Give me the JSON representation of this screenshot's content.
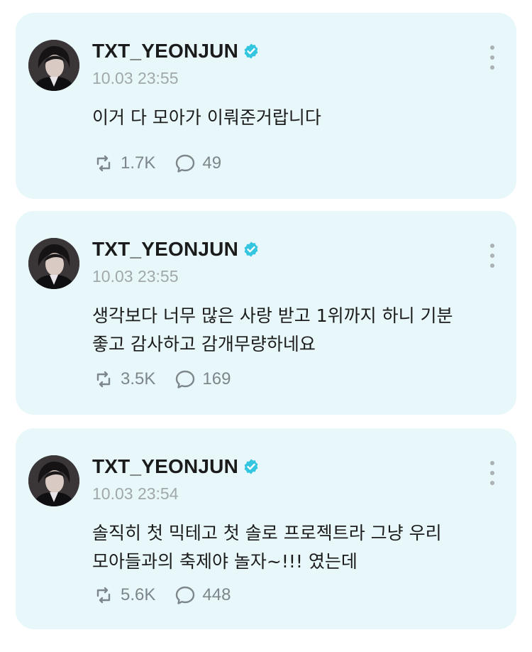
{
  "posts": [
    {
      "username": "TXT_YEONJUN",
      "timestamp": "10.03 23:55",
      "text": "이거 다 모아가 이뤄준거랍니다",
      "reposts": "1.7K",
      "comments": "49"
    },
    {
      "username": "TXT_YEONJUN",
      "timestamp": "10.03 23:55",
      "text": "생각보다 너무 많은 사랑 받고 1위까지 하니 기분\n좋고 감사하고 감개무량하네요",
      "reposts": "3.5K",
      "comments": "169"
    },
    {
      "username": "TXT_YEONJUN",
      "timestamp": "10.03 23:54",
      "text": "솔직히 첫 믹테고 첫 솔로 프로젝트라 그냥 우리\n모아들과의 축제야 놀자~!!! 였는데",
      "reposts": "5.6K",
      "comments": "448"
    }
  ],
  "icons": {
    "avatar": "profile-photo",
    "verified": "verified-badge-icon",
    "more": "more-vertical-icon",
    "repost": "repost-icon",
    "comment": "comment-bubble-icon"
  },
  "colors": {
    "card_background": "#e8f8fa",
    "verified_badge": "#34c5e0",
    "muted_text": "#a0a8ac",
    "count_text": "#7d868a"
  }
}
